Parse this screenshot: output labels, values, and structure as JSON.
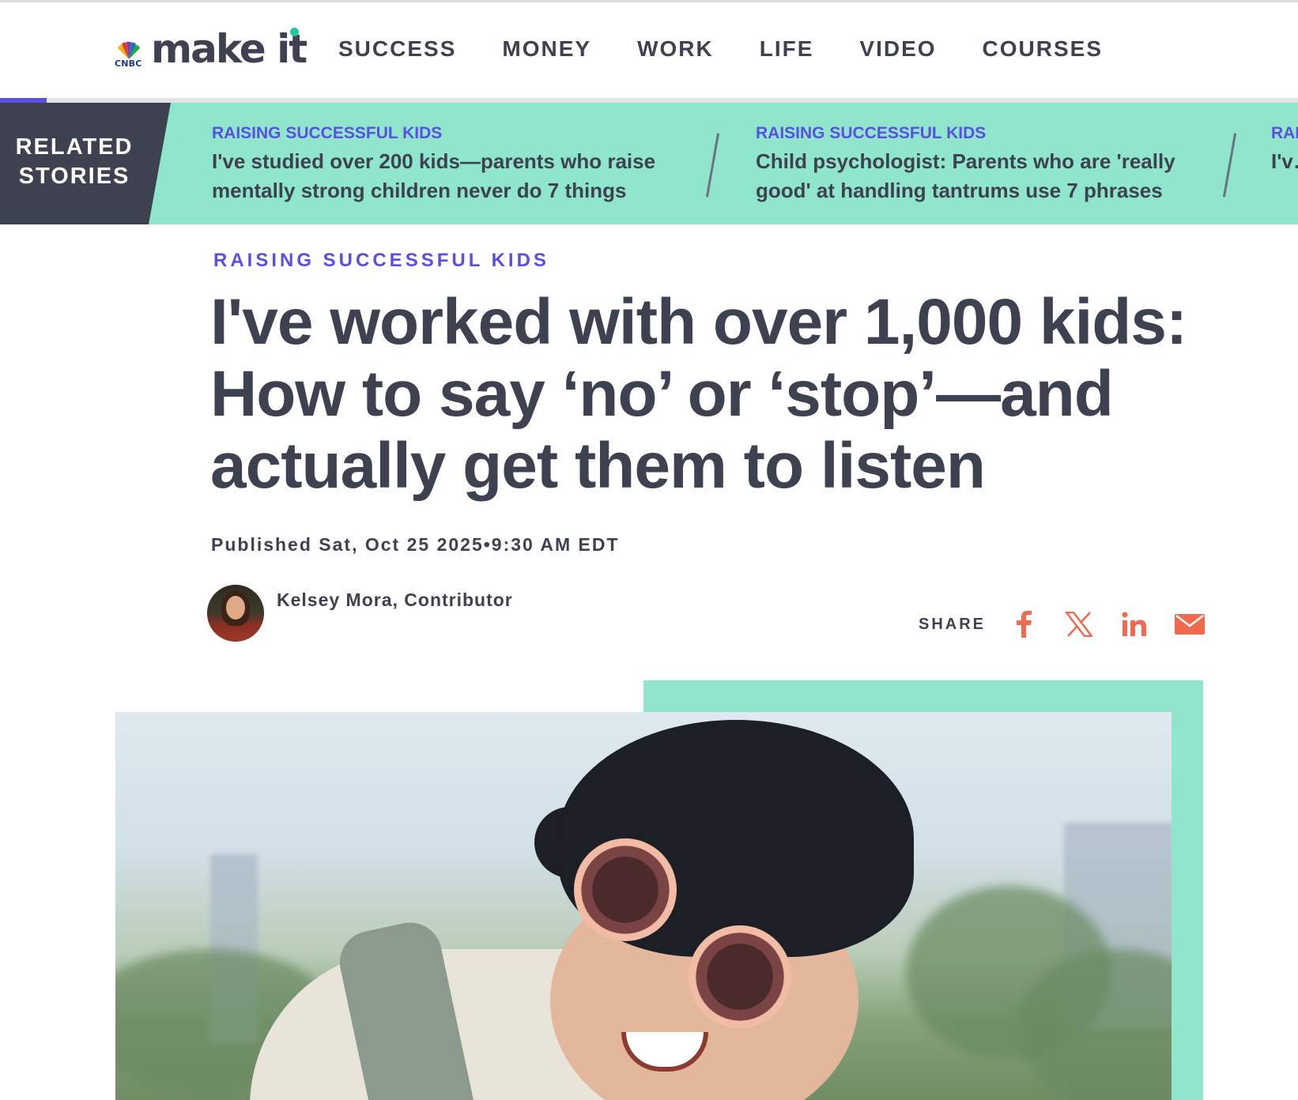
{
  "brand": {
    "network": "CNBC",
    "name": "make it",
    "colors": {
      "accent_purple": "#5a4fe3",
      "mint": "#8fe6cd",
      "dark": "#3e4250",
      "share_orange": "#ef6a4e"
    }
  },
  "nav": {
    "items": [
      "SUCCESS",
      "MONEY",
      "WORK",
      "LIFE",
      "VIDEO",
      "COURSES"
    ]
  },
  "reading_progress": 0.036,
  "related": {
    "label": "RELATED STORIES",
    "stories": [
      {
        "kicker": "RAISING SUCCESSFUL KIDS",
        "headline": "I've studied over 200 kids—parents who raise mentally strong children never do 7 things"
      },
      {
        "kicker": "RAISING SUCCESSFUL KIDS",
        "headline": "Child psychologist: Parents who are 'really good' at handling tantrums use 7 phrases"
      },
      {
        "kicker": "RAI",
        "headline": "I'v… th…"
      }
    ]
  },
  "article": {
    "kicker": "RAISING SUCCESSFUL KIDS",
    "title": "I've worked with over 1,000 kids: How to say ‘no’ or ‘stop’—and actually get them to listen",
    "published": "Published Sat, Oct 25 2025•9:30 AM EDT",
    "author": "Kelsey Mora, Contributor"
  },
  "share": {
    "label": "SHARE",
    "icons": [
      "facebook-icon",
      "x-icon",
      "linkedin-icon",
      "email-icon"
    ]
  }
}
